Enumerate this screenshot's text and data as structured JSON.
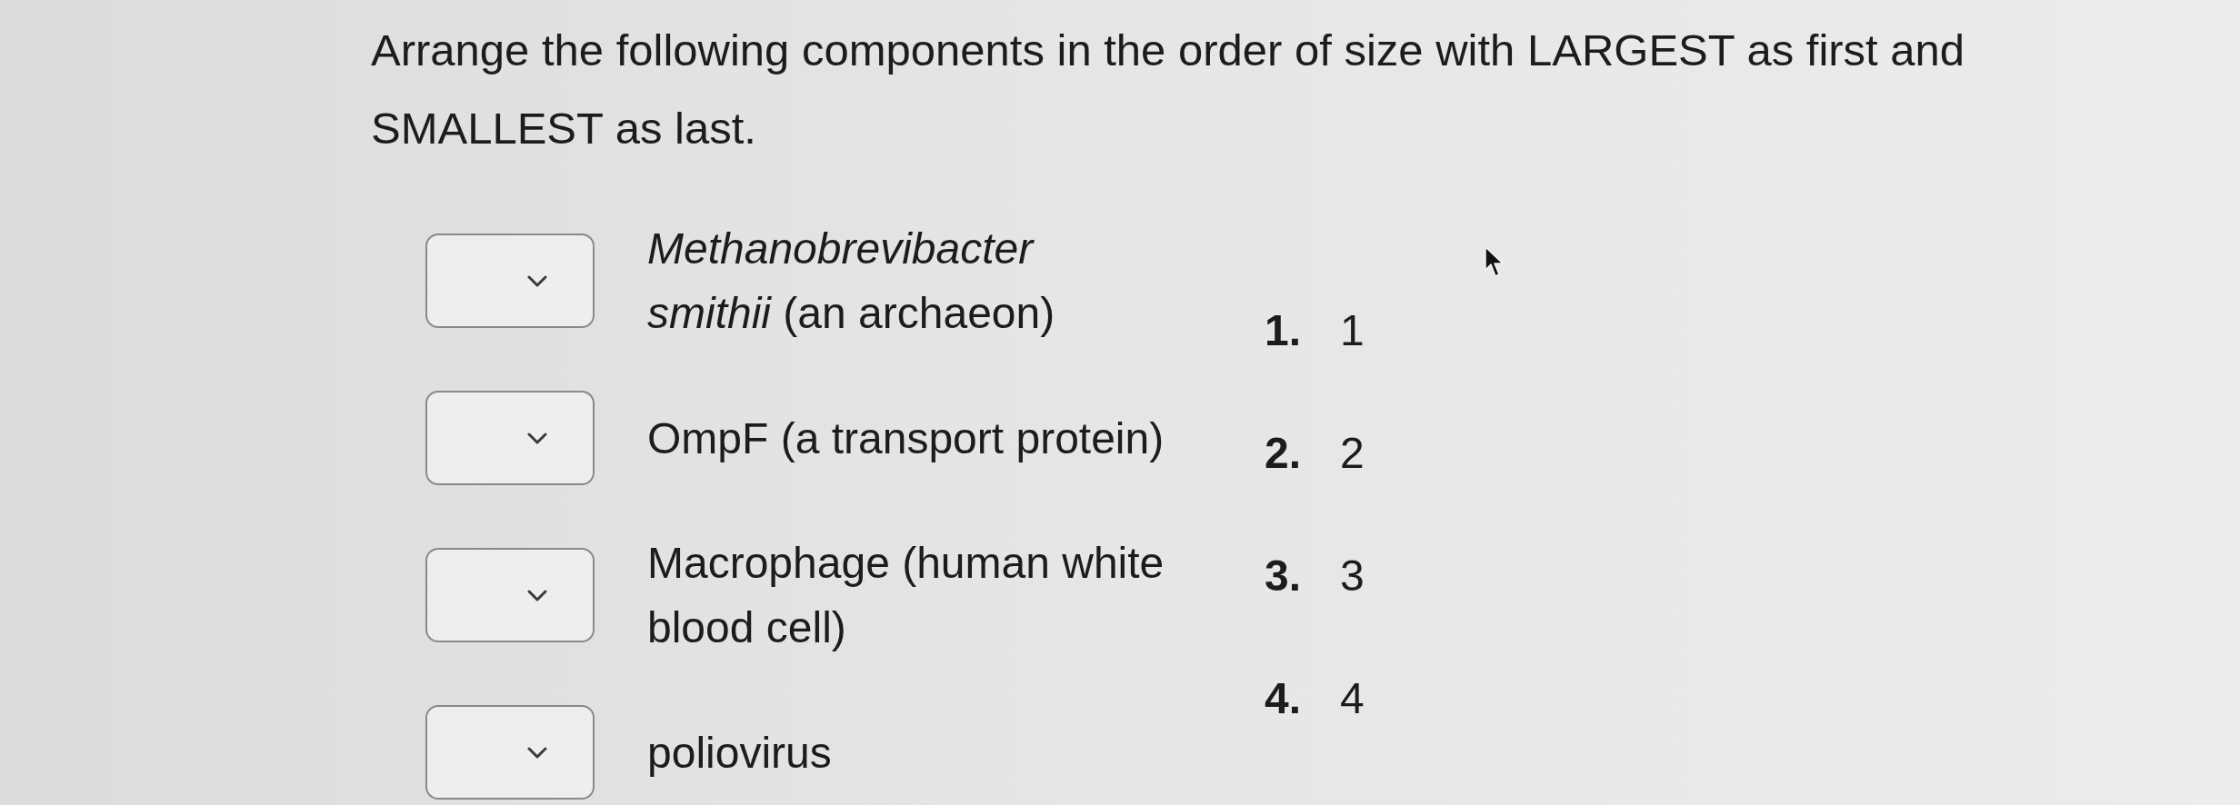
{
  "question": {
    "text": "Arrange the following components in the order of size with LARGEST as first and SMALLEST as last."
  },
  "items": [
    {
      "label": "*Methanobrevibacter smithii* (an archaeon)"
    },
    {
      "label": "OmpF (a transport protein)"
    },
    {
      "label": "Macrophage (human white blood cell)"
    },
    {
      "label": "poliovirus"
    }
  ],
  "order_list": [
    {
      "marker": "1.",
      "text": "1"
    },
    {
      "marker": "2.",
      "text": "2"
    },
    {
      "marker": "3.",
      "text": "3"
    },
    {
      "marker": "4.",
      "text": "4"
    }
  ]
}
